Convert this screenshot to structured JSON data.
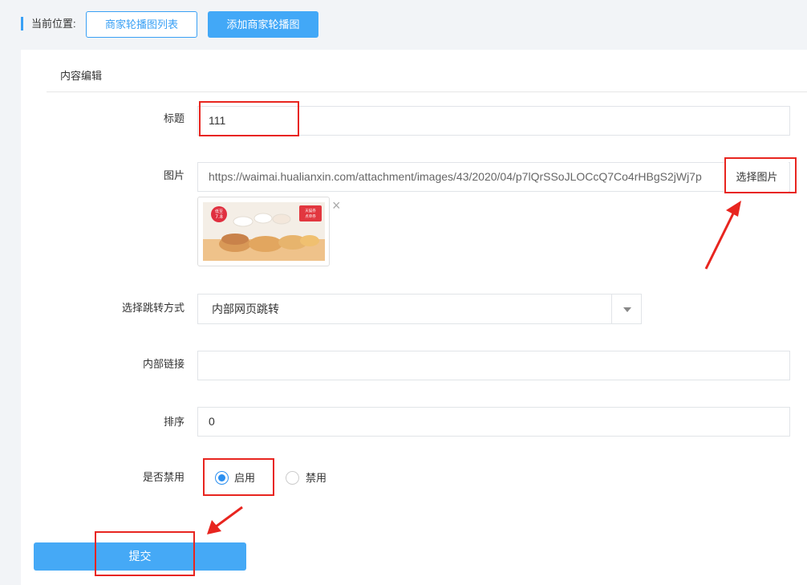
{
  "breadcrumb": {
    "label": "当前位置:",
    "list_button": "商家轮播图列表",
    "add_button": "添加商家轮播图"
  },
  "section": {
    "title": "内容编辑"
  },
  "form": {
    "title_label": "标题",
    "title_value": "111",
    "image_label": "图片",
    "image_url": "https://waimai.hualianxin.com/attachment/images/43/2020/04/p7lQrSSoJLOCcQ7Co4rHBgS2jWj7p",
    "choose_image_button": "选择图片",
    "remove_icon": "×",
    "thumb_badge_1": "低至",
    "thumb_badge_2": "7.8",
    "thumb_corner_1": "天猫券",
    "thumb_corner_2": "点单券",
    "jump_label": "选择跳转方式",
    "jump_value": "内部网页跳转",
    "link_label": "内部链接",
    "link_value": "",
    "sort_label": "排序",
    "sort_value": "0",
    "disable_label": "是否禁用",
    "radio_enable": "启用",
    "radio_disable": "禁用",
    "submit": "提交"
  },
  "colors": {
    "accent": "#39a0f5",
    "annotation": "#e8251f"
  },
  "icons": {
    "dropdown": "chevron-down-icon",
    "remove": "close-icon",
    "radio": "radio-icon"
  }
}
